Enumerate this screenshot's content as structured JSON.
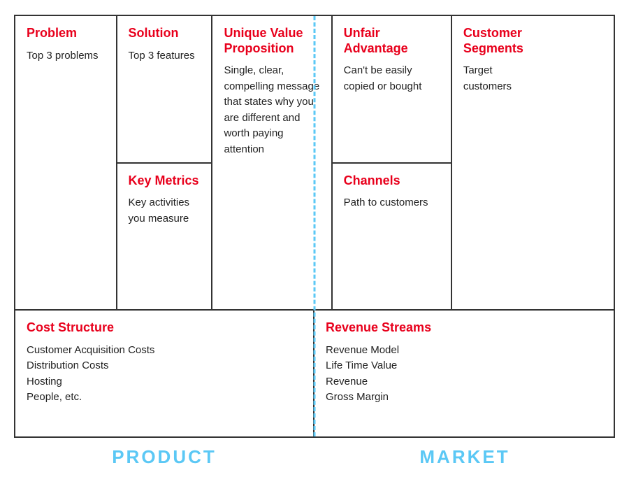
{
  "cells": {
    "problem": {
      "title": "Problem",
      "body": "Top 3 problems"
    },
    "solution": {
      "title": "Solution",
      "body": "Top 3 features"
    },
    "key_metrics": {
      "title": "Key Metrics",
      "body": "Key activities you measure"
    },
    "uvp": {
      "title": "Unique Value Proposition",
      "body": "Single, clear, compelling message that states why you are different and worth paying attention"
    },
    "unfair_advantage": {
      "title": "Unfair Advantage",
      "body": "Can't be easily copied or bought"
    },
    "channels": {
      "title": "Channels",
      "body": "Path to customers"
    },
    "customer_segments": {
      "title": "Customer Segments",
      "body": "Target customers"
    },
    "cost_structure": {
      "title": "Cost Structure",
      "body_lines": [
        "Customer Acquisition Costs",
        "Distribution Costs",
        "Hosting",
        "People, etc."
      ]
    },
    "revenue_streams": {
      "title": "Revenue Streams",
      "body_lines": [
        "Revenue Model",
        "Life Time Value",
        "Revenue",
        "Gross Margin"
      ]
    }
  },
  "footer": {
    "product_label": "PRODUCT",
    "market_label": "MARKET"
  }
}
